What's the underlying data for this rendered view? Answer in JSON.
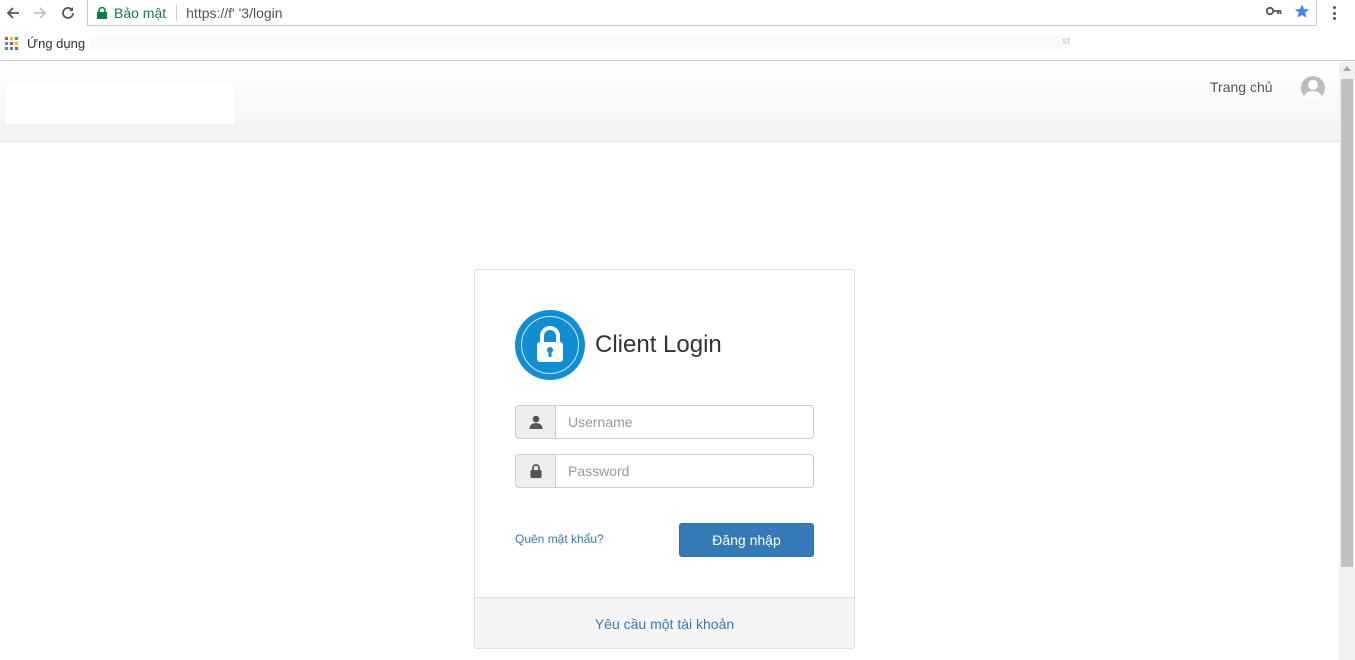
{
  "browser": {
    "secure_label": "Bảo mật",
    "url": "https://f'    '3/login",
    "bookmarks": {
      "apps_label": "Ứng dụng",
      "trailing_fragment": "st"
    },
    "colors": {
      "secure": "#0b8043",
      "star": "#4285f4"
    },
    "icons": [
      "back-icon",
      "forward-icon",
      "reload-icon",
      "lock-icon",
      "key-icon",
      "star-icon",
      "more-vert-icon",
      "apps-grid-icon"
    ]
  },
  "header": {
    "nav_home": "Trang chủ",
    "avatar_icon": "user-avatar-icon"
  },
  "login": {
    "title": "Client Login",
    "username_placeholder": "Username",
    "password_placeholder": "Password",
    "forgot_link": "Quên mật khẩu?",
    "submit_label": "Đăng nhập",
    "request_account_link": "Yêu cầu một tài khoản",
    "colors": {
      "accent": "#337ab7",
      "lock_badge": "#0f8ed4"
    },
    "icons": [
      "padlock-icon",
      "user-icon",
      "lock-icon"
    ]
  }
}
